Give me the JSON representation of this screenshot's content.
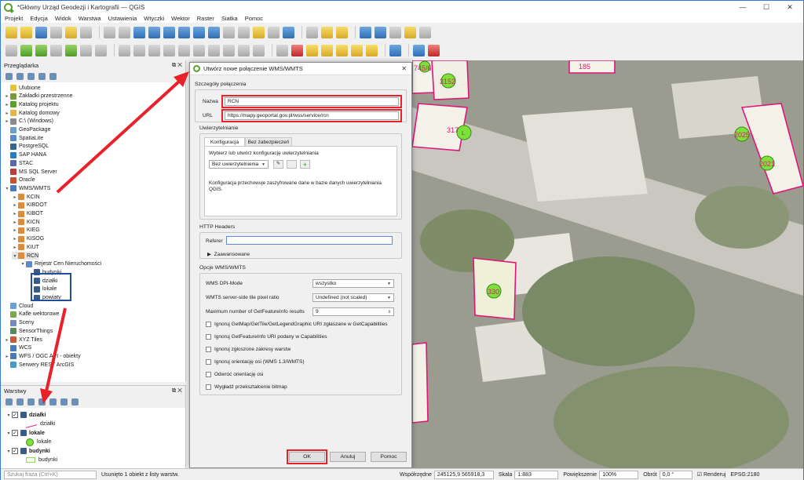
{
  "window": {
    "title": "*Główny Urząd Geodezji i Kartografii — QGIS"
  },
  "menu": [
    "Projekt",
    "Edycja",
    "Widok",
    "Warstwa",
    "Ustawienia",
    "Wtyczki",
    "Wektor",
    "Raster",
    "Siatka",
    "Pomoc"
  ],
  "browser": {
    "title": "Przeglądarka",
    "items": [
      {
        "label": "Ulubione",
        "depth": 0,
        "arrow": "",
        "icon": "star-icon",
        "color": "#e9c13a"
      },
      {
        "label": "Zakładki przestrzenne",
        "depth": 0,
        "arrow": "▸",
        "icon": "bookmark-icon",
        "color": "#7a9a3a"
      },
      {
        "label": "Katalog projektu",
        "depth": 0,
        "arrow": "▸",
        "icon": "folder-icon",
        "color": "#5aa02c"
      },
      {
        "label": "Katalog domowy",
        "depth": 0,
        "arrow": "▸",
        "icon": "folder-icon",
        "color": "#e2b64a"
      },
      {
        "label": "C:\\ (Windows)",
        "depth": 0,
        "arrow": "▸",
        "icon": "folder-icon",
        "color": "#8a8a8a"
      },
      {
        "label": "GeoPackage",
        "depth": 0,
        "arrow": "",
        "icon": "geopackage-icon",
        "color": "#6aa0c8"
      },
      {
        "label": "SpatiaLite",
        "depth": 0,
        "arrow": "",
        "icon": "spatialite-icon",
        "color": "#5a8ac8"
      },
      {
        "label": "PostgreSQL",
        "depth": 0,
        "arrow": "",
        "icon": "postgresql-icon",
        "color": "#336791"
      },
      {
        "label": "SAP HANA",
        "depth": 0,
        "arrow": "",
        "icon": "sap-hana-icon",
        "color": "#2a7ac0"
      },
      {
        "label": "STAC",
        "depth": 0,
        "arrow": "",
        "icon": "stac-icon",
        "color": "#5a6aa8"
      },
      {
        "label": "MS SQL Server",
        "depth": 0,
        "arrow": "",
        "icon": "mssql-icon",
        "color": "#c03a3a"
      },
      {
        "label": "Oracle",
        "depth": 0,
        "arrow": "",
        "icon": "oracle-icon",
        "color": "#c8502a"
      },
      {
        "label": "WMS/WMTS",
        "depth": 0,
        "arrow": "▾",
        "icon": "globe-icon",
        "color": "#4a7ab8"
      },
      {
        "label": "KCIN",
        "depth": 1,
        "arrow": "▸",
        "icon": "wms-connection-icon",
        "color": "#e08a3a"
      },
      {
        "label": "KIBDOT",
        "depth": 1,
        "arrow": "▸",
        "icon": "wms-connection-icon",
        "color": "#e08a3a"
      },
      {
        "label": "KIBOT",
        "depth": 1,
        "arrow": "▸",
        "icon": "wms-connection-icon",
        "color": "#e08a3a"
      },
      {
        "label": "KICN",
        "depth": 1,
        "arrow": "▸",
        "icon": "wms-connection-icon",
        "color": "#e08a3a"
      },
      {
        "label": "KIEG",
        "depth": 1,
        "arrow": "▸",
        "icon": "wms-connection-icon",
        "color": "#e08a3a"
      },
      {
        "label": "KISOG",
        "depth": 1,
        "arrow": "▸",
        "icon": "wms-connection-icon",
        "color": "#e08a3a"
      },
      {
        "label": "KIUT",
        "depth": 1,
        "arrow": "▸",
        "icon": "wms-connection-icon",
        "color": "#e08a3a"
      },
      {
        "label": "RCN",
        "depth": 1,
        "arrow": "▾",
        "icon": "wms-connection-icon",
        "color": "#e08a3a"
      },
      {
        "label": "Rejestr Cen Nieruchomości",
        "depth": 2,
        "arrow": "▾",
        "icon": "wms-layer-icon",
        "color": "#5a8ac8"
      },
      {
        "label": "budynki",
        "depth": 3,
        "arrow": "",
        "icon": "raster-layer-icon",
        "color": "#3a5a8a"
      },
      {
        "label": "działki",
        "depth": 3,
        "arrow": "",
        "icon": "raster-layer-icon",
        "color": "#3a5a8a"
      },
      {
        "label": "lokale",
        "depth": 3,
        "arrow": "",
        "icon": "raster-layer-icon",
        "color": "#3a5a8a"
      },
      {
        "label": "powiaty",
        "depth": 3,
        "arrow": "",
        "icon": "raster-layer-icon",
        "color": "#3a5a8a"
      },
      {
        "label": "Cloud",
        "depth": 0,
        "arrow": "",
        "icon": "cloud-icon",
        "color": "#6aa0d8"
      },
      {
        "label": "Kafle wektorowe",
        "depth": 0,
        "arrow": "",
        "icon": "vector-tiles-icon",
        "color": "#7aa84a"
      },
      {
        "label": "Sceny",
        "depth": 0,
        "arrow": "",
        "icon": "scene-icon",
        "color": "#7a8ab8"
      },
      {
        "label": "SensorThings",
        "depth": 0,
        "arrow": "",
        "icon": "sensor-icon",
        "color": "#5a8a5a"
      },
      {
        "label": "XYZ Tiles",
        "depth": 0,
        "arrow": "▸",
        "icon": "xyz-tiles-icon",
        "color": "#c85a3a"
      },
      {
        "label": "WCS",
        "depth": 0,
        "arrow": "",
        "icon": "wcs-icon",
        "color": "#4a7ab8"
      },
      {
        "label": "WFS / OGC API - obiekty",
        "depth": 0,
        "arrow": "▸",
        "icon": "wfs-icon",
        "color": "#4a7ab8"
      },
      {
        "label": "Serwery REST ArcGIS",
        "depth": 0,
        "arrow": "",
        "icon": "arcgis-icon",
        "color": "#4a9ac8"
      }
    ]
  },
  "layers": {
    "title": "Warstwy",
    "items": [
      {
        "label": "działki",
        "bold": true,
        "type": "group"
      },
      {
        "label": "działki",
        "bold": false,
        "type": "symbol-line"
      },
      {
        "label": "lokale",
        "bold": true,
        "type": "group"
      },
      {
        "label": "lokale",
        "bold": false,
        "type": "symbol-point"
      },
      {
        "label": "budynki",
        "bold": true,
        "type": "group"
      },
      {
        "label": "budynki",
        "bold": false,
        "type": "symbol-polygon"
      }
    ]
  },
  "dialog": {
    "title": "Utwórz nowe połączenie WMS/WMTS",
    "details_label": "Szczegóły połączenia",
    "name_label": "Nazwa",
    "name_value": "RCN",
    "url_label": "URL",
    "url_value": "https://mapy.geoportal.gov.pl/wss/service/rcn",
    "auth_label": "Uwierzytelnianie",
    "tab_config": "Konfiguracja",
    "tab_basic": "Bez zabezpieczeń",
    "auth_choose": "Wybierz lub utwórz konfigurację uwierzytelniania",
    "auth_select": "Bez uwierzytelnienia",
    "auth_note": "Konfiguracja przechowuje zaszyfrowane dane w bazie danych uwierzytelniania QGIS.",
    "http_headers_label": "HTTP Headers",
    "referer_label": "Referer",
    "referer_value": "",
    "advanced_label": "Zaawansowane",
    "wms_options_label": "Opcje WMS/WMTS",
    "dpi_label": "WMS DPI-Mode",
    "dpi_value": "wszystko",
    "tile_label": "WMTS server-side tile pixel ratio",
    "tile_value": "Undefined (not scaled)",
    "maxfeat_label": "Maximum number of GetFeatureInfo results",
    "maxfeat_value": "9",
    "checkboxes": [
      "Ignoruj GetMap/GetTile/GetLegendGraphic URI zgłaszane w GetCapabilities",
      "Ignoruj GetFeatureInfo URI podany w Capabilities",
      "Ignoruj zgłoszone zakresy warstw",
      "Ignoruj orientację osi (WMS 1.3/WMTS)",
      "Odwróć orientację osi",
      "Wygładź przekształcenie bitmap"
    ],
    "ok_label": "OK",
    "cancel_label": "Anuluj",
    "help_label": "Pomoc"
  },
  "map": {
    "labels": [
      "745/6",
      "3152",
      "185",
      "317",
      "L",
      "2025",
      "2021",
      "330"
    ]
  },
  "status": {
    "search_placeholder": "Szukaj fraza (Ctrl+K)",
    "message": "Usunięto 1 obiekt z listy warstw.",
    "coord_label": "Współrzędne",
    "coord_value": "245125,9  565918,3",
    "scale_label": "Skala",
    "scale_value": "1:883",
    "zoom_label": "Powiększenie",
    "zoom_value": "100%",
    "rotation_label": "Obrót",
    "rotation_value": "0,0 °",
    "render_label": "Renderuj",
    "crs_label": "EPSG:2180"
  },
  "colors": {
    "highlight_red": "#e8212a",
    "highlight_blue": "#1f4f9a",
    "parcel_outline": "#e0157a",
    "point_fill": "#7ee03a"
  }
}
